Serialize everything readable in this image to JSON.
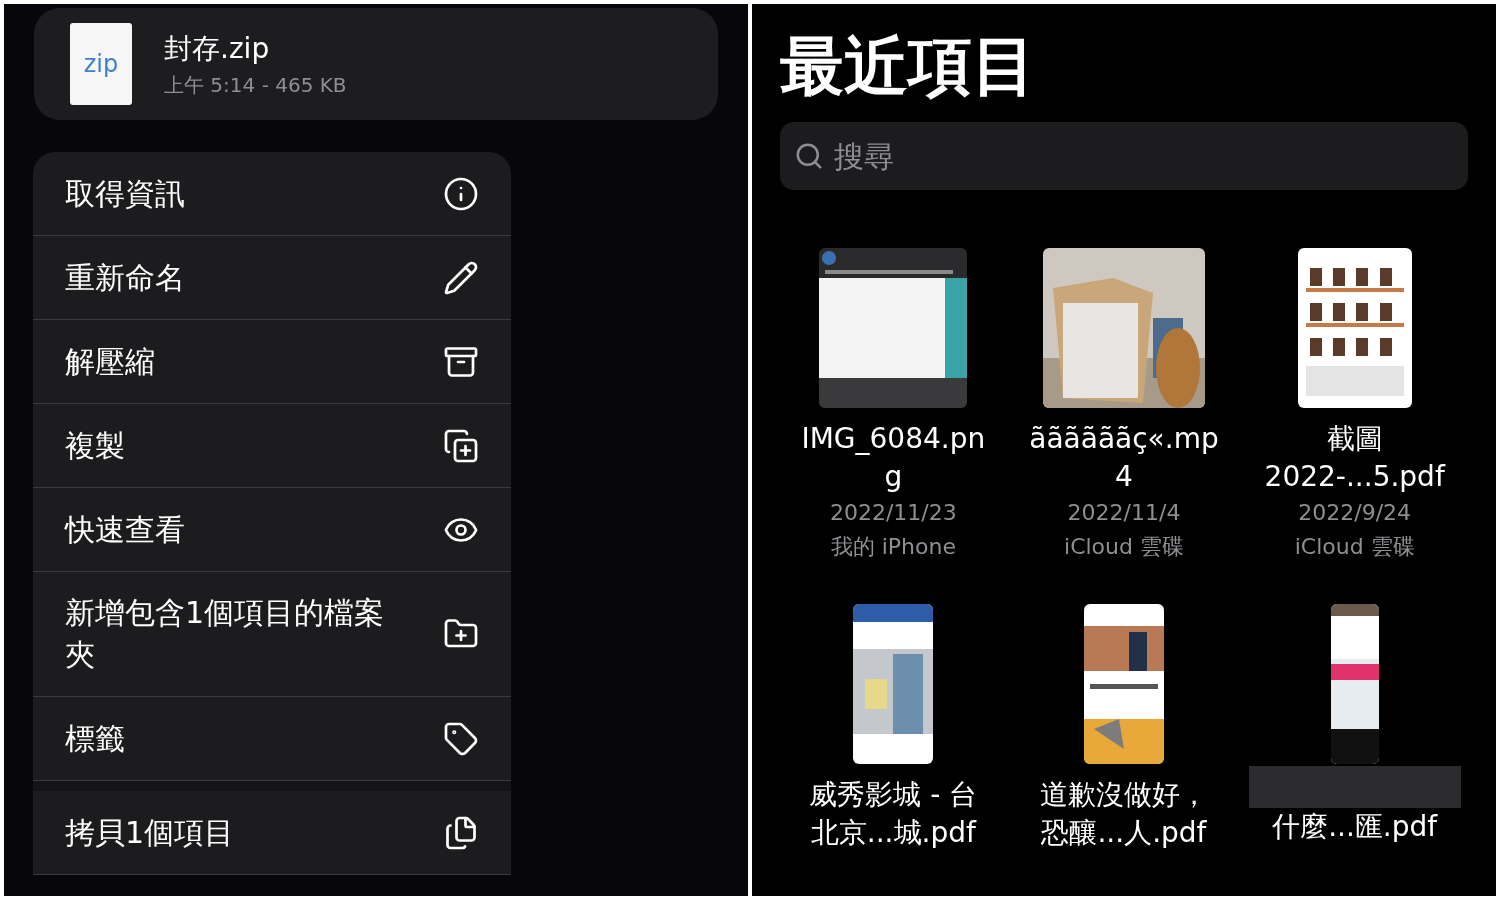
{
  "file_card": {
    "icon_label": "zip",
    "name": "封存.zip",
    "meta": "上午 5:14 - 465 KB"
  },
  "menu_groups": [
    [
      {
        "label": "取得資訊"
      },
      {
        "label": "重新命名"
      },
      {
        "label": "解壓縮"
      },
      {
        "label": "複製"
      },
      {
        "label": "快速查看"
      },
      {
        "label": "新增包含1個項目的檔案夾"
      },
      {
        "label": "標籤"
      }
    ],
    [
      {
        "label": "拷貝1個項目"
      }
    ]
  ],
  "recents": {
    "title": "最近項目",
    "search": {
      "placeholder": "搜尋"
    },
    "files": [
      {
        "name_lines": [
          "IMG_6084.pn",
          "g"
        ],
        "date": "2022/11/23",
        "location": "我的 iPhone",
        "blurred": false
      },
      {
        "name_lines": [
          "ããããããç«.mp",
          "4"
        ],
        "date": "2022/11/4",
        "location": "iCloud 雲碟",
        "blurred": false
      },
      {
        "name_lines": [
          "截圖",
          "2022-...5.pdf"
        ],
        "date": "2022/9/24",
        "location": "iCloud 雲碟",
        "blurred": false
      },
      {
        "name_lines": [
          "威秀影城 - 台",
          "北京...城.pdf"
        ],
        "blurred": false
      },
      {
        "name_lines": [
          "道歉沒做好，",
          "恐釀...人.pdf"
        ],
        "blurred": false
      },
      {
        "name_lines": [
          "什麼...匯.pdf"
        ],
        "blurred": true
      }
    ]
  }
}
